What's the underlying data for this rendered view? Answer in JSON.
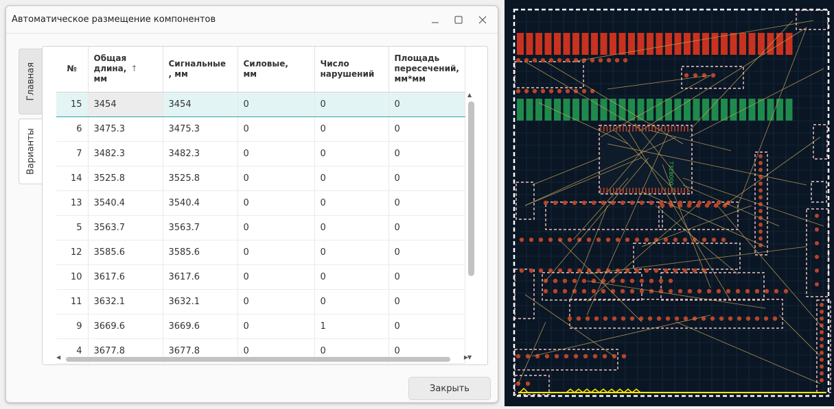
{
  "dialog": {
    "title": "Автоматическое размещение компонентов",
    "window_controls": [
      "minimize-icon",
      "maximize-icon",
      "close-icon"
    ],
    "tabs": [
      {
        "label": "Главная",
        "active": false
      },
      {
        "label": "Варианты",
        "active": true
      }
    ],
    "table": {
      "columns": [
        "№",
        "Общая длина, мм",
        "Сигнальные, мм",
        "Силовые, мм",
        "Число нарушений",
        "Площадь пересечений, мм*мм"
      ],
      "header": {
        "num": "№",
        "total_length": "Общая длина,",
        "total_length_unit": "мм",
        "sort_indicator": "↑",
        "signal": "Сигнальные",
        "signal_unit": ", мм",
        "power": "Силовые,",
        "power_unit": "мм",
        "violations": "Число",
        "violations_2": "нарушений",
        "area": "Площадь",
        "area_2": "пересечений,",
        "area_3": "мм*мм"
      },
      "rows": [
        {
          "num": "15",
          "total": "3454",
          "signal": "3454",
          "power": "0",
          "violations": "0",
          "area": "0"
        },
        {
          "num": "6",
          "total": "3475.3",
          "signal": "3475.3",
          "power": "0",
          "violations": "0",
          "area": "0"
        },
        {
          "num": "7",
          "total": "3482.3",
          "signal": "3482.3",
          "power": "0",
          "violations": "0",
          "area": "0"
        },
        {
          "num": "14",
          "total": "3525.8",
          "signal": "3525.8",
          "power": "0",
          "violations": "0",
          "area": "0"
        },
        {
          "num": "13",
          "total": "3540.4",
          "signal": "3540.4",
          "power": "0",
          "violations": "0",
          "area": "0"
        },
        {
          "num": "5",
          "total": "3563.7",
          "signal": "3563.7",
          "power": "0",
          "violations": "0",
          "area": "0"
        },
        {
          "num": "12",
          "total": "3585.6",
          "signal": "3585.6",
          "power": "0",
          "violations": "0",
          "area": "0"
        },
        {
          "num": "10",
          "total": "3617.6",
          "signal": "3617.6",
          "power": "0",
          "violations": "0",
          "area": "0"
        },
        {
          "num": "11",
          "total": "3632.1",
          "signal": "3632.1",
          "power": "0",
          "violations": "0",
          "area": "0"
        },
        {
          "num": "9",
          "total": "3669.6",
          "signal": "3669.6",
          "power": "0",
          "violations": "1",
          "area": "0"
        },
        {
          "num": "4",
          "total": "3677.8",
          "signal": "3677.8",
          "power": "0",
          "violations": "0",
          "area": "0"
        }
      ],
      "selected_row": 0
    },
    "close_button": "Закрыть"
  },
  "pcb_view": {
    "chip_label": "7328000",
    "colors": {
      "background": "#0a1624",
      "grid": "#1d3347",
      "board_outline": "#ffffff",
      "red_connector": "#c8321e",
      "green_connector": "#1f8a4c",
      "component_outline": "#f2c6c6",
      "ratsnest": "#c8a35a",
      "pad": "#b9442a",
      "bottom_line": "#ffe600",
      "dialog_accent": "#2aa4a4"
    }
  }
}
